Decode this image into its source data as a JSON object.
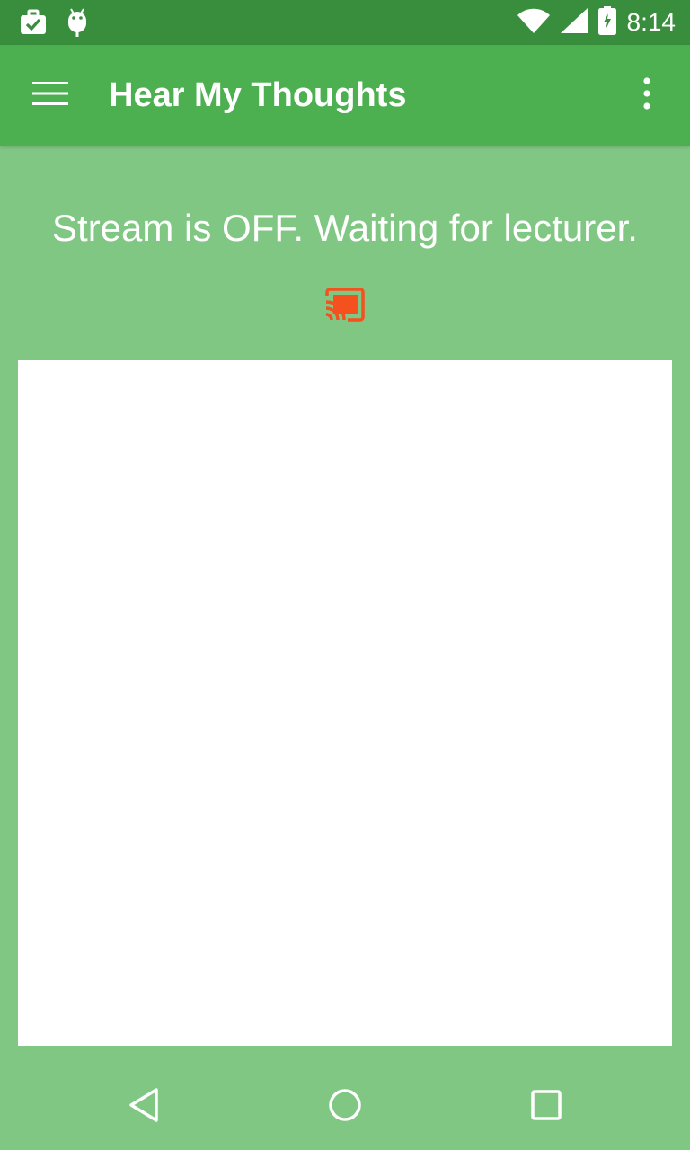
{
  "status_bar": {
    "time": "8:14",
    "left_icons": [
      "briefcase-check-icon",
      "android-debug-icon"
    ],
    "right_icons": [
      "wifi-icon",
      "cell-signal-icon",
      "battery-charging-icon"
    ]
  },
  "app_bar": {
    "title": "Hear My Thoughts",
    "menu_icon": "hamburger-menu-icon",
    "overflow_icon": "more-vert-icon"
  },
  "main": {
    "stream_status": "Stream is OFF. Waiting for lecturer.",
    "cast_icon": "cast-connected-icon"
  },
  "nav_bar": {
    "buttons": [
      "back-icon",
      "home-icon",
      "recents-icon"
    ]
  },
  "colors": {
    "status_bar": "#388e3c",
    "app_bar": "#4caf50",
    "background": "#81c784",
    "cast_accent": "#f4511e",
    "panel": "#ffffff"
  }
}
